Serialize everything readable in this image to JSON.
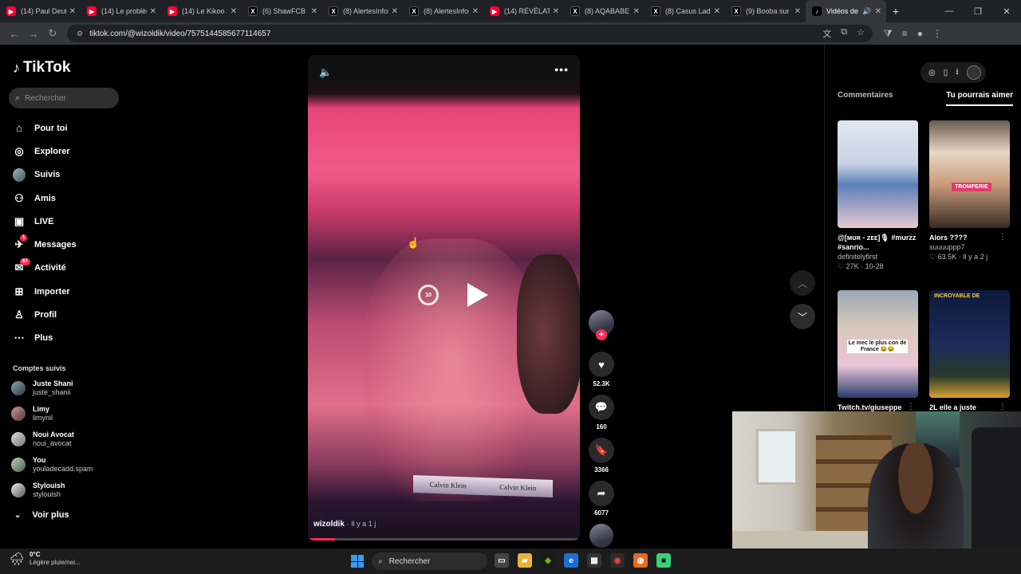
{
  "browser": {
    "tabs": [
      {
        "label": "(14) Paul Deutsc",
        "type": "yt"
      },
      {
        "label": "(14) Le problème",
        "type": "yt"
      },
      {
        "label": "(14) Le Kikoo Sé",
        "type": "yt"
      },
      {
        "label": "(6) ShawFCB sur",
        "type": "x"
      },
      {
        "label": "(8) AlertesInfos",
        "type": "x"
      },
      {
        "label": "(8) AlertesInfos",
        "type": "x"
      },
      {
        "label": "(14) RÉVÉLATIO",
        "type": "yt"
      },
      {
        "label": "(8) AQABABE s",
        "type": "x"
      },
      {
        "label": "(8) Casus Lady",
        "type": "x"
      },
      {
        "label": "(9) Booba sur X",
        "type": "x"
      },
      {
        "label": "Vidéos de",
        "type": "tk",
        "active": true
      }
    ],
    "url": "tiktok.com/@wizoldik/video/7575144585677114657"
  },
  "sidebar": {
    "logo": "TikTok",
    "search_placeholder": "Rechercher",
    "nav": [
      {
        "label": "Pour toi",
        "icon": "home-icon"
      },
      {
        "label": "Explorer",
        "icon": "compass-icon"
      },
      {
        "label": "Suivis",
        "icon": "avatar-icon"
      },
      {
        "label": "Amis",
        "icon": "friends-icon"
      },
      {
        "label": "LIVE",
        "icon": "live-icon"
      },
      {
        "label": "Messages",
        "icon": "messages-icon",
        "badge": "1"
      },
      {
        "label": "Activité",
        "icon": "activity-icon",
        "badge": "67"
      },
      {
        "label": "Importer",
        "icon": "upload-icon"
      },
      {
        "label": "Profil",
        "icon": "profile-icon"
      },
      {
        "label": "Plus",
        "icon": "more-icon"
      }
    ],
    "followed_title": "Comptes suivis",
    "followed": [
      {
        "name": "Juste Shani",
        "user": "juste_shanii"
      },
      {
        "name": "Limy",
        "user": "limynil"
      },
      {
        "name": "Noui Avocat",
        "user": "noui_avocat"
      },
      {
        "name": "You",
        "user": "youladecadd.spam"
      },
      {
        "name": "Stylouish",
        "user": "stylouish"
      }
    ],
    "see_more": "Voir plus"
  },
  "video": {
    "author": "wizoldik",
    "time": "· Il y a 1 j",
    "replay_label": "10",
    "progress": 0.1,
    "band_text": "Calvin Klein"
  },
  "actions": {
    "likes": "52.3K",
    "comments": "160",
    "saves": "3366",
    "shares": "6077"
  },
  "right": {
    "tab_comments": "Commentaires",
    "tab_suggested": "Tu pourrais aimer",
    "cards": [
      {
        "title": "@[ᴍᴜʀ - ᴢᴇᴇ]🎙 #murzz #sanrio...",
        "user": "definitelyfirst",
        "meta": "♡ 27K · 10-28"
      },
      {
        "title": "Alors ????",
        "user": "suuuuppp7",
        "meta": "♡ 63.5K · Il y a 2 j",
        "overlay": "TROMPERIE"
      },
      {
        "title": "Twitch.tv/giuseppe",
        "user": "",
        "meta": "",
        "overlay": "Le mec le plus con de France 😂😂"
      },
      {
        "title": "2L elle a juste",
        "user": "",
        "meta": "",
        "overlay": "INCROYABLE DE"
      }
    ]
  },
  "taskbar": {
    "weather_temp": "0°C",
    "weather_desc": "Légère pluie/nei...",
    "search": "Rechercher"
  }
}
